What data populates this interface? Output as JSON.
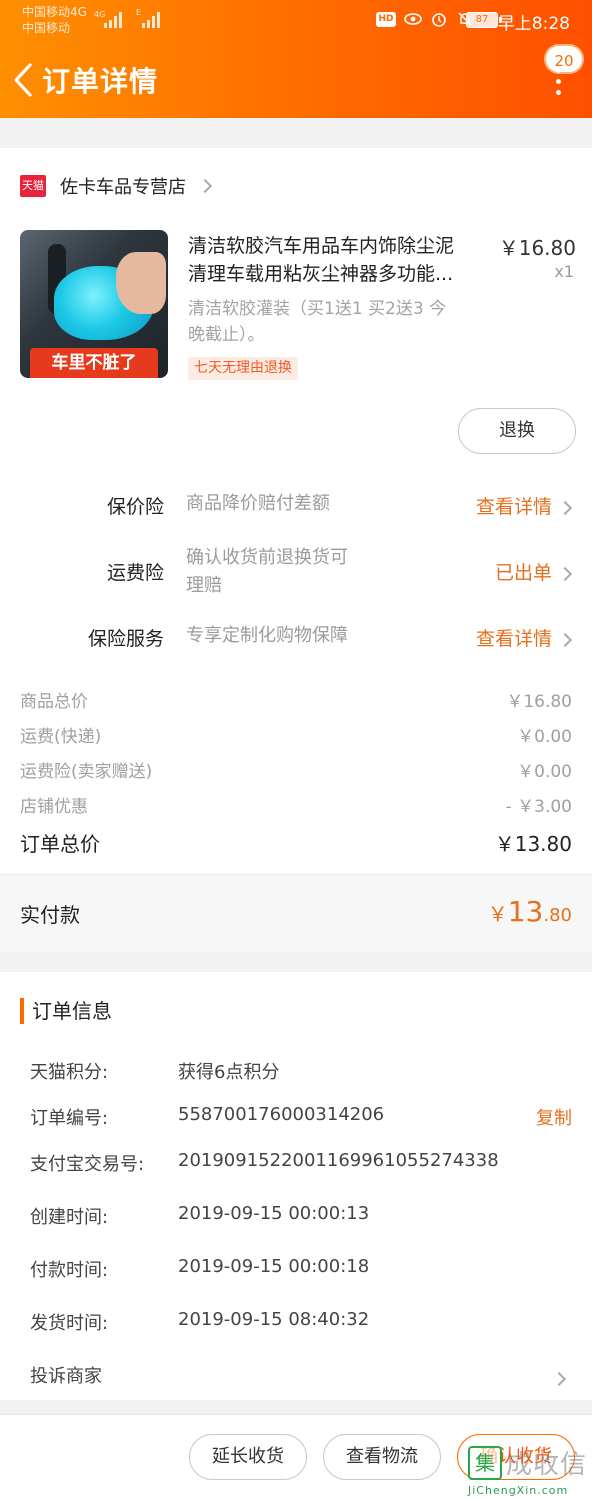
{
  "status_bar": {
    "carrier1": "中国移动4G",
    "carrier2": "中国移动",
    "net1": "4G",
    "net2": "E",
    "hd": "HD",
    "battery": "87",
    "time": "早上8:28"
  },
  "header": {
    "title": "订单详情",
    "badge": "20"
  },
  "store": {
    "logo_text": "天猫",
    "name": "佐卡车品专营店"
  },
  "product": {
    "image_caption": "车里不脏了",
    "title_line1": "清洁软胶汽车用品车内饰除尘泥",
    "title_line2": "清理车载用粘灰尘神器多功能...",
    "price": "￥16.80",
    "qty": "x1",
    "spec_line1": "清洁软胶灌装（买1送1 买2送3 今",
    "spec_line2": "晚截止）。",
    "tag": "七天无理由退换",
    "return_button": "退换"
  },
  "insurance": [
    {
      "label": "保价险",
      "desc": "商品降价赔付差额",
      "action": "查看详情"
    },
    {
      "label": "运费险",
      "desc_line1": "确认收货前退换货可",
      "desc_line2": "理赔",
      "action": "已出单"
    },
    {
      "label": "保险服务",
      "desc": "专享定制化购物保障",
      "action": "查看详情"
    }
  ],
  "fees": [
    {
      "label": "商品总价",
      "value": "￥16.80"
    },
    {
      "label": "运费(快递)",
      "value": "￥0.00"
    },
    {
      "label": "运费险(卖家赠送)",
      "value": "￥0.00"
    },
    {
      "label": "店铺优惠",
      "value": "- ￥3.00"
    }
  ],
  "order_total": {
    "label": "订单总价",
    "value": "￥13.80"
  },
  "paid": {
    "label": "实付款",
    "currency": "￥",
    "integer": "13",
    "decimal": ".80"
  },
  "order_info": {
    "heading": "订单信息",
    "rows": [
      {
        "key": "天猫积分:",
        "value": "获得6点积分"
      },
      {
        "key": "订单编号:",
        "value": "558700176000314206",
        "action": "复制"
      },
      {
        "key": "支付宝交易号:",
        "value": "2019091522001169961055274338"
      },
      {
        "key": "创建时间:",
        "value": "2019-09-15 00:00:13"
      },
      {
        "key": "付款时间:",
        "value": "2019-09-15 00:00:18"
      },
      {
        "key": "发货时间:",
        "value": "2019-09-15 08:40:32"
      }
    ],
    "complaint": "投诉商家"
  },
  "bottom_bar": {
    "extend": "延长收货",
    "logistics": "查看物流",
    "confirm": "确认收货"
  },
  "watermark": {
    "box": "集",
    "cn": "成收信",
    "en": "JiChengXin.com"
  },
  "colors": {
    "brand": "#ff6a00",
    "accent_text": "#e86f1d",
    "tmall_red": "#e8233b"
  }
}
